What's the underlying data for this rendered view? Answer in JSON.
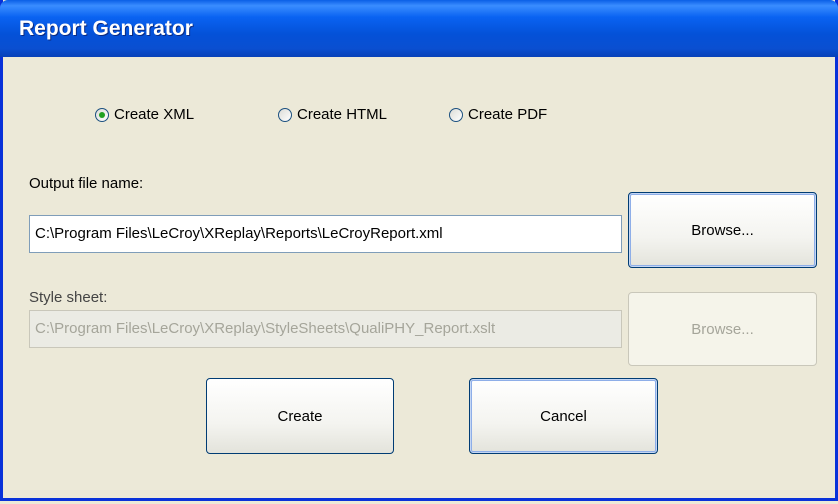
{
  "window": {
    "title": "Report Generator"
  },
  "format": {
    "options": [
      {
        "label": "Create XML",
        "selected": true
      },
      {
        "label": "Create HTML",
        "selected": false
      },
      {
        "label": "Create PDF",
        "selected": false
      }
    ]
  },
  "output": {
    "label": "Output file name:",
    "value": "C:\\Program Files\\LeCroy\\XReplay\\Reports\\LeCroyReport.xml",
    "browse_label": "Browse..."
  },
  "stylesheet": {
    "label": "Style sheet:",
    "value": "C:\\Program Files\\LeCroy\\XReplay\\StyleSheets\\QualiPHY_Report.xslt",
    "browse_label": "Browse...",
    "disabled": true
  },
  "actions": {
    "create_label": "Create",
    "cancel_label": "Cancel"
  }
}
